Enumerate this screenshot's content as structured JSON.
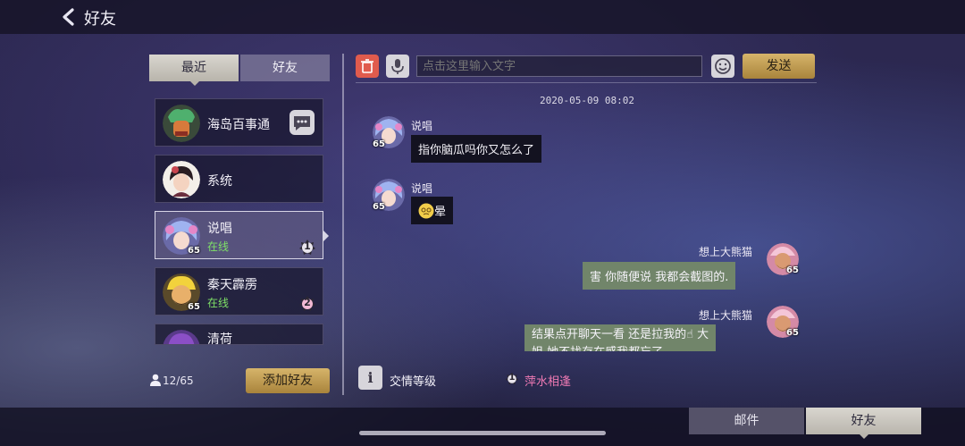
{
  "header": {
    "title": "好友"
  },
  "list_tabs": [
    {
      "label": "最近",
      "active": true
    },
    {
      "label": "好友",
      "active": false
    }
  ],
  "friends": [
    {
      "name": "海岛百事通",
      "has_message_button": true
    },
    {
      "name": "系统"
    },
    {
      "name": "说唱",
      "status": "在线",
      "level": "65",
      "badge": "1",
      "selected": true
    },
    {
      "name": "秦天霹雳",
      "status": "在线",
      "level": "65",
      "badge": "2"
    },
    {
      "name": "清荷"
    }
  ],
  "friend_count": "12/65",
  "add_friend_label": "添加好友",
  "chat": {
    "input_placeholder": "点击这里输入文字",
    "send_label": "发送",
    "timestamp": "2020-05-09  08:02",
    "messages": [
      {
        "side": "left",
        "sender": "说唱",
        "level": "65",
        "text": "指你脑瓜吗你又怎么了"
      },
      {
        "side": "left",
        "sender": "说唱",
        "level": "65",
        "text": "晕",
        "emoji": "dizzy-face"
      },
      {
        "side": "right",
        "sender": "想上大熊猫",
        "level": "65",
        "text": "害 你随便说 我都会截图的."
      },
      {
        "side": "right",
        "sender": "想上大熊猫",
        "level": "65",
        "text_line1": "结果点开聊天一看 还是拉我的☝ 大",
        "text_line2": "姐 她不找存在感我都忘了"
      }
    ]
  },
  "relationship": {
    "label": "交情等级",
    "level": "1",
    "title": "萍水相逢"
  },
  "bottom_tabs": [
    {
      "label": "邮件",
      "active": false
    },
    {
      "label": "好友",
      "active": true
    }
  ],
  "colors": {
    "accent_gold": "#c9a458",
    "online": "#7ee067",
    "relation_pink": "#f07ab4",
    "my_bubble": "#71856a"
  }
}
